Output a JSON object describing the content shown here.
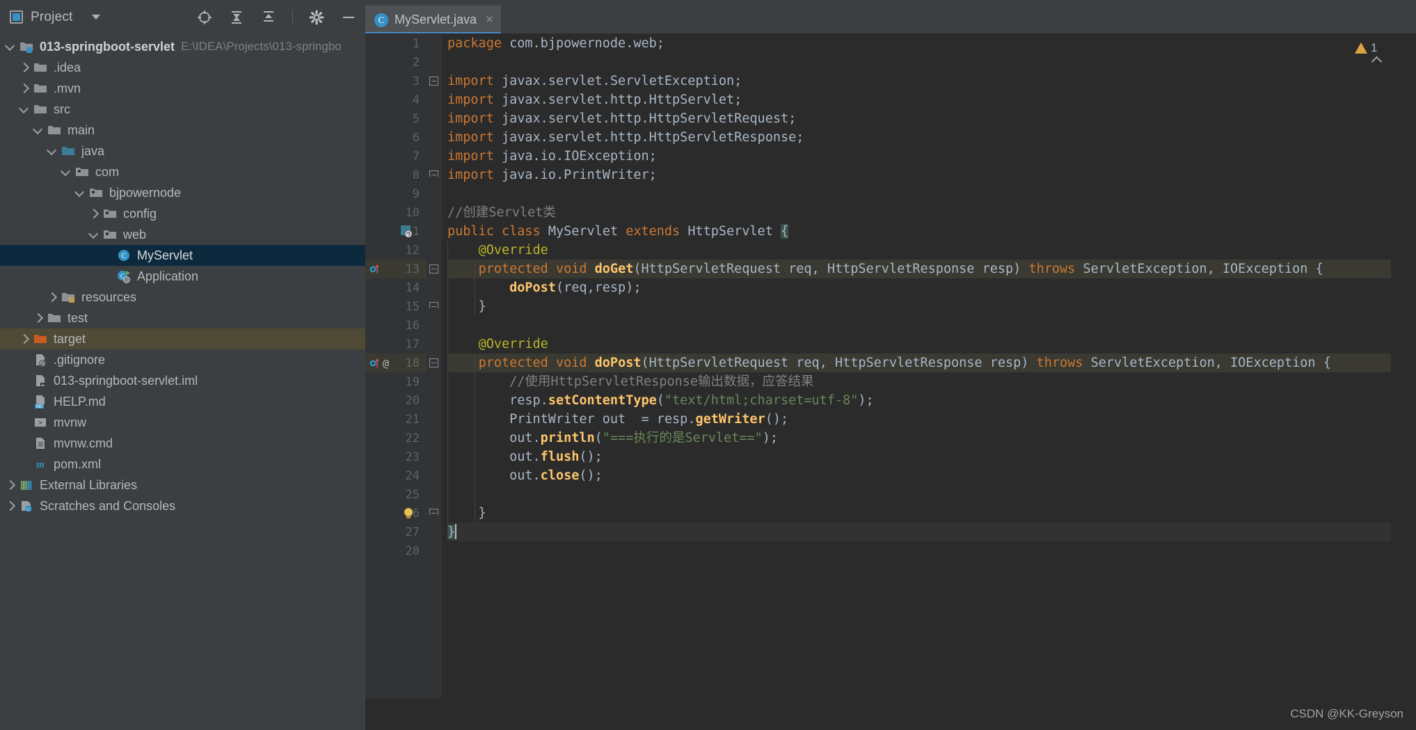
{
  "window": {
    "tool_panel_title": "Project",
    "watermark": "CSDN @KK-Greyson"
  },
  "toolbar": {
    "icons": [
      {
        "name": "locate-icon",
        "glyph": "target"
      },
      {
        "name": "collapse-all-icon",
        "glyph": "collapse"
      },
      {
        "name": "expand-all-icon",
        "glyph": "expand"
      },
      {
        "name": "settings-gear-icon",
        "glyph": "gear"
      },
      {
        "name": "hide-panel-icon",
        "glyph": "minus"
      }
    ]
  },
  "tabs": [
    {
      "label": "MyServlet.java",
      "icon": "java-class-icon",
      "icon_letter": "C",
      "active": true,
      "close_glyph": "×"
    }
  ],
  "sidebar": {
    "items": [
      {
        "label": "013-springboot-servlet",
        "path": "E:\\IDEA\\Projects\\013-springbo",
        "indent": 0,
        "arrow": "open",
        "icon": "module-folder-icon",
        "bold": true,
        "state": "normal"
      },
      {
        "label": ".idea",
        "path": "",
        "indent": 1,
        "arrow": "closed",
        "icon": "folder-icon",
        "bold": false,
        "state": "normal"
      },
      {
        "label": ".mvn",
        "path": "",
        "indent": 1,
        "arrow": "closed",
        "icon": "folder-icon",
        "bold": false,
        "state": "normal"
      },
      {
        "label": "src",
        "path": "",
        "indent": 1,
        "arrow": "open",
        "icon": "folder-icon",
        "bold": false,
        "state": "normal"
      },
      {
        "label": "main",
        "path": "",
        "indent": 2,
        "arrow": "open",
        "icon": "folder-icon",
        "bold": false,
        "state": "normal"
      },
      {
        "label": "java",
        "path": "",
        "indent": 3,
        "arrow": "open",
        "icon": "source-root-icon",
        "bold": false,
        "state": "normal"
      },
      {
        "label": "com",
        "path": "",
        "indent": 4,
        "arrow": "open",
        "icon": "package-icon",
        "bold": false,
        "state": "normal"
      },
      {
        "label": "bjpowernode",
        "path": "",
        "indent": 5,
        "arrow": "open",
        "icon": "package-icon",
        "bold": false,
        "state": "normal"
      },
      {
        "label": "config",
        "path": "",
        "indent": 6,
        "arrow": "closed",
        "icon": "package-icon",
        "bold": false,
        "state": "normal"
      },
      {
        "label": "web",
        "path": "",
        "indent": 6,
        "arrow": "open",
        "icon": "package-icon",
        "bold": false,
        "state": "normal"
      },
      {
        "label": "MyServlet",
        "path": "",
        "indent": 7,
        "arrow": "none",
        "icon": "java-class-icon",
        "bold": false,
        "state": "selected"
      },
      {
        "label": "Application",
        "path": "",
        "indent": 7,
        "arrow": "none",
        "icon": "java-runnable-class-icon",
        "bold": false,
        "state": "normal"
      },
      {
        "label": "resources",
        "path": "",
        "indent": 3,
        "arrow": "closed",
        "icon": "resource-root-icon",
        "bold": false,
        "state": "normal"
      },
      {
        "label": "test",
        "path": "",
        "indent": 2,
        "arrow": "closed",
        "icon": "folder-icon",
        "bold": false,
        "state": "normal"
      },
      {
        "label": "target",
        "path": "",
        "indent": 1,
        "arrow": "closed",
        "icon": "excluded-folder-icon",
        "bold": false,
        "state": "highlighted"
      },
      {
        "label": ".gitignore",
        "path": "",
        "indent": 1,
        "arrow": "none",
        "icon": "gitignore-file-icon",
        "bold": false,
        "state": "normal"
      },
      {
        "label": "013-springboot-servlet.iml",
        "path": "",
        "indent": 1,
        "arrow": "none",
        "icon": "iml-file-icon",
        "bold": false,
        "state": "normal"
      },
      {
        "label": "HELP.md",
        "path": "",
        "indent": 1,
        "arrow": "none",
        "icon": "markdown-file-icon",
        "bold": false,
        "state": "normal"
      },
      {
        "label": "mvnw",
        "path": "",
        "indent": 1,
        "arrow": "none",
        "icon": "shell-script-icon",
        "bold": false,
        "state": "normal"
      },
      {
        "label": "mvnw.cmd",
        "path": "",
        "indent": 1,
        "arrow": "none",
        "icon": "cmd-script-icon",
        "bold": false,
        "state": "normal"
      },
      {
        "label": "pom.xml",
        "path": "",
        "indent": 1,
        "arrow": "none",
        "icon": "maven-pom-icon",
        "bold": false,
        "state": "normal"
      },
      {
        "label": "External Libraries",
        "path": "",
        "indent": 0,
        "arrow": "closed",
        "icon": "external-libraries-icon",
        "bold": false,
        "state": "normal"
      },
      {
        "label": "Scratches and Consoles",
        "path": "",
        "indent": 0,
        "arrow": "closed",
        "icon": "scratches-icon",
        "bold": false,
        "state": "normal"
      }
    ]
  },
  "editor": {
    "file_name": "MyServlet.java",
    "line_numbers": [
      1,
      2,
      3,
      4,
      5,
      6,
      7,
      8,
      9,
      10,
      11,
      12,
      13,
      14,
      15,
      16,
      17,
      18,
      19,
      20,
      21,
      22,
      23,
      24,
      25,
      26,
      27,
      28
    ],
    "lines": [
      {
        "n": 1,
        "text": "package com.bjpowernode.web;"
      },
      {
        "n": 2,
        "text": ""
      },
      {
        "n": 3,
        "text": "import javax.servlet.ServletException;"
      },
      {
        "n": 4,
        "text": "import javax.servlet.http.HttpServlet;"
      },
      {
        "n": 5,
        "text": "import javax.servlet.http.HttpServletRequest;"
      },
      {
        "n": 6,
        "text": "import javax.servlet.http.HttpServletResponse;"
      },
      {
        "n": 7,
        "text": "import java.io.IOException;"
      },
      {
        "n": 8,
        "text": "import java.io.PrintWriter;"
      },
      {
        "n": 9,
        "text": ""
      },
      {
        "n": 10,
        "text": "//创建Servlet类"
      },
      {
        "n": 11,
        "text": "public class MyServlet extends HttpServlet {"
      },
      {
        "n": 12,
        "text": "    @Override"
      },
      {
        "n": 13,
        "text": "    protected void doGet(HttpServletRequest req, HttpServletResponse resp) throws ServletException, IOException {"
      },
      {
        "n": 14,
        "text": "        doPost(req,resp);"
      },
      {
        "n": 15,
        "text": "    }"
      },
      {
        "n": 16,
        "text": ""
      },
      {
        "n": 17,
        "text": "    @Override"
      },
      {
        "n": 18,
        "text": "    protected void doPost(HttpServletRequest req, HttpServletResponse resp) throws ServletException, IOException {"
      },
      {
        "n": 19,
        "text": "        //使用HttpServletResponse输出数据，应答结果"
      },
      {
        "n": 20,
        "text": "        resp.setContentType(\"text/html;charset=utf-8\");"
      },
      {
        "n": 21,
        "text": "        PrintWriter out  = resp.getWriter();"
      },
      {
        "n": 22,
        "text": "        out.println(\"===执行的是Servlet==\");"
      },
      {
        "n": 23,
        "text": "        out.flush();"
      },
      {
        "n": 24,
        "text": "        out.close();"
      },
      {
        "n": 25,
        "text": ""
      },
      {
        "n": 26,
        "text": "    }"
      },
      {
        "n": 27,
        "text": "}"
      },
      {
        "n": 28,
        "text": ""
      }
    ],
    "inspection": {
      "warning_count": "1",
      "warning_color": "#d9a343"
    }
  },
  "colors": {
    "editor_bg": "#2b2b2b",
    "panel_bg": "#3c3f41",
    "gutter_bg": "#313335",
    "selection_bg": "#0d293e",
    "target_highlight_bg": "#4e4a35",
    "accent_blue": "#3592c4",
    "tab_underline": "#4a88c7",
    "keyword": "#cc7832",
    "string": "#6a8759",
    "comment": "#808080",
    "annotation": "#bbb529",
    "method": "#ffc66d",
    "default_text": "#a9b7c6"
  }
}
